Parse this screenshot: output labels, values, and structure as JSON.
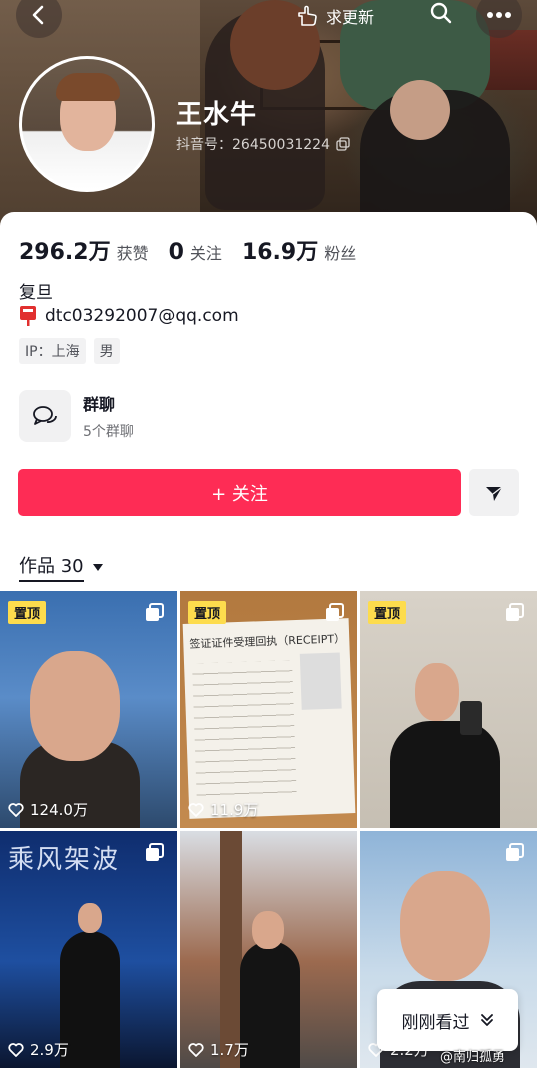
{
  "header": {
    "update_label": "求更新",
    "name": "王水牛",
    "douyin_id": "抖音号：26450031224"
  },
  "stats": [
    {
      "value": "296.2万",
      "label": "获赞"
    },
    {
      "value": "0",
      "label": "关注"
    },
    {
      "value": "16.9万",
      "label": "粉丝"
    }
  ],
  "bio": {
    "school": "复旦",
    "email": "dtc03292007@qq.com",
    "tags": [
      "IP：上海",
      "男"
    ]
  },
  "group_chat": {
    "title": "群聊",
    "subtitle": "5个群聊"
  },
  "actions": {
    "follow_label": "+ 关注"
  },
  "works_tab": {
    "label": "作品 30"
  },
  "videos": [
    {
      "pinned_label": "置顶",
      "likes": "124.0万"
    },
    {
      "pinned_label": "置顶",
      "likes": "11.9万",
      "doc_title": "签证证件受理回执（RECEIPT）"
    },
    {
      "pinned_label": "置顶",
      "likes": ""
    },
    {
      "pinned_label": "",
      "likes": "2.9万",
      "overlay_text": "乘风架波"
    },
    {
      "pinned_label": "",
      "likes": "1.7万"
    },
    {
      "pinned_label": "",
      "likes": "2.2万"
    }
  ],
  "recent_popup": {
    "label": "刚刚看过"
  },
  "watermark": "@南归孤勇"
}
